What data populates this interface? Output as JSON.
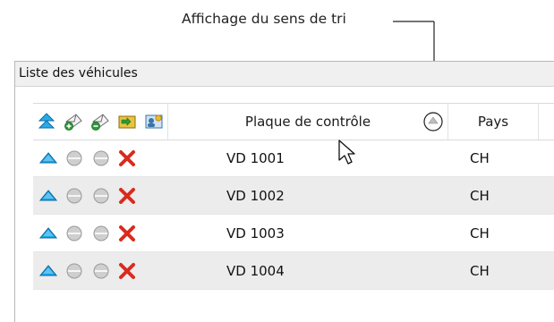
{
  "callout": {
    "label": "Affichage du sens de tri"
  },
  "group": {
    "title": "Liste des véhicules"
  },
  "table": {
    "header_icons": [
      "sort-up-icon",
      "envelope-add-icon",
      "envelope-remove-icon",
      "vehicle-exchange-icon",
      "user-group-icon"
    ],
    "columns": {
      "plate": "Plaque de contrôle",
      "country": "Pays"
    },
    "sort_indicator": "sort-ascending-icon",
    "rows": [
      {
        "plate": "VD 1001",
        "country": "CH"
      },
      {
        "plate": "VD 1002",
        "country": "CH"
      },
      {
        "plate": "VD 1003",
        "country": "CH"
      },
      {
        "plate": "VD 1004",
        "country": "CH"
      }
    ],
    "row_icons": [
      "blue-triangle-icon",
      "grey-disc-icon",
      "grey-disc-icon",
      "red-x-icon"
    ]
  },
  "colors": {
    "accent_blue": "#1aa6e6",
    "alt_row": "#ececec",
    "delete_red": "#d92b1e"
  }
}
